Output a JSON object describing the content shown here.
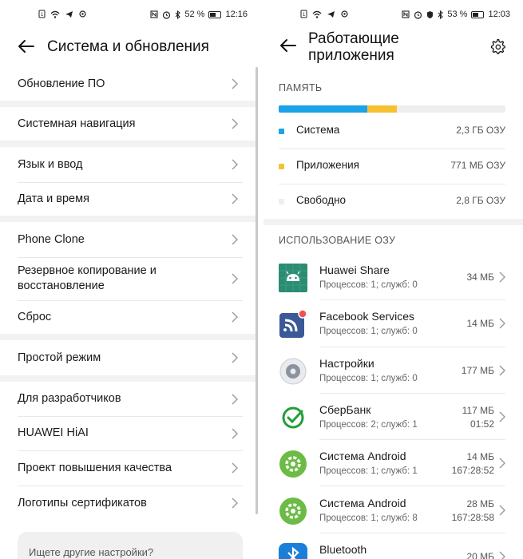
{
  "colors": {
    "memory_system": "#1aa3e8",
    "memory_apps": "#f5c130",
    "memory_free": "#eeeeee",
    "android_green": "#6cbb45",
    "sber_green": "#21a038",
    "huawei_share_bg": "#2b8c72",
    "facebook_blue": "#3b5998",
    "badge_red": "#f25050"
  },
  "memory_usage": {
    "system_fraction": 0.39,
    "apps_fraction": 0.13
  },
  "left": {
    "status": {
      "battery": "52 %",
      "time": "12:16"
    },
    "title": "Система и обновления",
    "items": [
      {
        "label": "Обновление ПО"
      },
      {
        "label": "Системная навигация"
      },
      {
        "label": "Язык и ввод"
      },
      {
        "label": "Дата и время"
      },
      {
        "label": "Phone Clone"
      },
      {
        "label": "Резервное копирование и восстановление"
      },
      {
        "label": "Сброс"
      },
      {
        "label": "Простой режим"
      },
      {
        "label": "Для разработчиков"
      },
      {
        "label": "HUAWEI HiAI"
      },
      {
        "label": "Проект повышения качества"
      },
      {
        "label": "Логотипы сертификатов"
      }
    ],
    "search_placeholder": "Ищете другие настройки?"
  },
  "right": {
    "status": {
      "battery": "53 %",
      "time": "12:03"
    },
    "title_line1": "Работающие",
    "title_line2": "приложения",
    "memory_label": "ПАМЯТЬ",
    "legend": [
      {
        "name": "Система",
        "value": "2,3 ГБ ОЗУ"
      },
      {
        "name": "Приложения",
        "value": "771 МБ ОЗУ"
      },
      {
        "name": "Свободно",
        "value": "2,8 ГБ ОЗУ"
      }
    ],
    "usage_label": "ИСПОЛЬЗОВАНИЕ ОЗУ",
    "apps": [
      {
        "name": "Huawei Share",
        "sub": "Процессов: 1; служб: 0",
        "mem": "34 МБ",
        "time": "",
        "icon": "android-icon"
      },
      {
        "name": "Facebook Services",
        "sub": "Процессов: 1; служб: 0",
        "mem": "14 МБ",
        "time": "",
        "icon": "facebook-services-icon"
      },
      {
        "name": "Настройки",
        "sub": "Процессов: 1; служб: 0",
        "mem": "177 МБ",
        "time": "",
        "icon": "settings-app-icon"
      },
      {
        "name": "СберБанк",
        "sub": "Процессов: 2; служб: 1",
        "mem": "117 МБ",
        "time": "01:52",
        "icon": "sberbank-icon"
      },
      {
        "name": "Система Android",
        "sub": "Процессов: 1; служб: 1",
        "mem": "14 МБ",
        "time": "167:28:52",
        "icon": "android-system-icon"
      },
      {
        "name": "Система Android",
        "sub": "Процессов: 1; служб: 8",
        "mem": "28 МБ",
        "time": "167:28:58",
        "icon": "android-system-icon"
      },
      {
        "name": "Bluetooth",
        "sub": "",
        "mem": "20 МБ",
        "time": "",
        "icon": "bluetooth-icon"
      }
    ]
  }
}
